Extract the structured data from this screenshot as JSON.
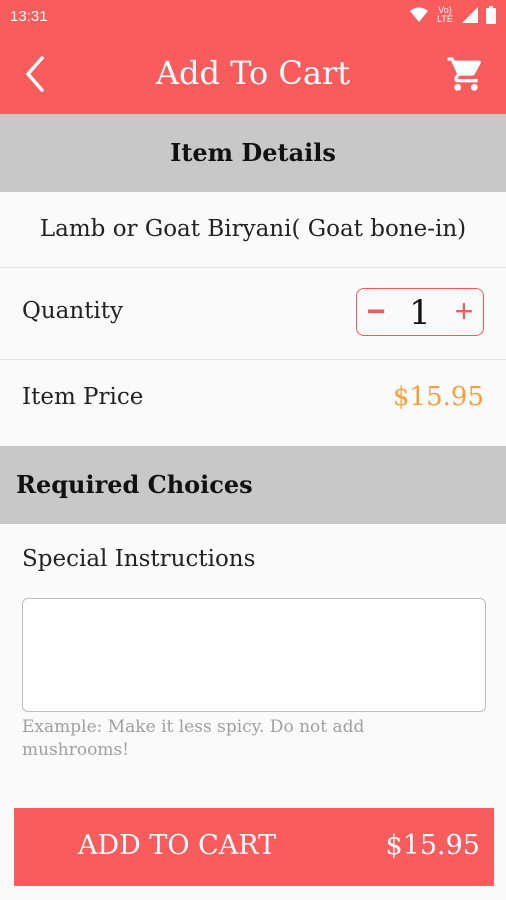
{
  "status_bar": {
    "time": "13:31",
    "network_label": "Vo) LTE",
    "icons": [
      "wifi-icon",
      "network-icon",
      "signal-icon",
      "battery-icon"
    ]
  },
  "app_bar": {
    "title": "Add To Cart",
    "back_icon": "back-arrow-icon",
    "cart_icon": "shopping-cart-icon"
  },
  "item_details": {
    "header": "Item Details",
    "name": "Lamb or Goat Biryani( Goat bone-in)",
    "quantity_label": "Quantity",
    "quantity_value": "1",
    "price_label": "Item Price",
    "price_value": "$15.95"
  },
  "required_choices": {
    "header": "Required Choices"
  },
  "special_instructions": {
    "label": "Special Instructions",
    "value": "",
    "hint": "Example: Make it less spicy. Do not add mushrooms!"
  },
  "add_to_cart_button": {
    "label": "ADD TO CART",
    "price": "$15.95"
  },
  "colors": {
    "primary": "#f85c5c",
    "price_accent": "#f2a23c",
    "section_bg": "#c8c8c8"
  }
}
